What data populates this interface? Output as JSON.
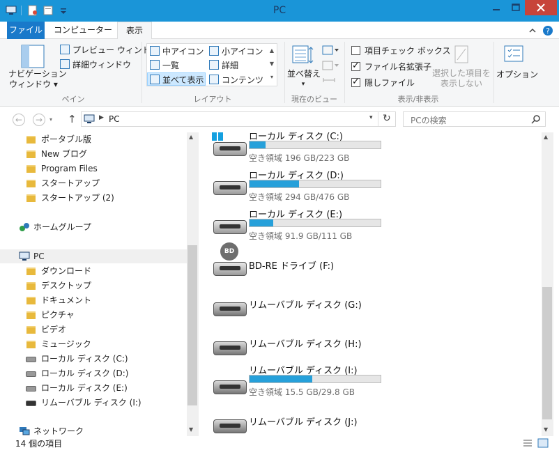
{
  "window": {
    "title": "PC"
  },
  "ribbon_tabs": {
    "file": "ファイル",
    "computer": "コンピューター",
    "view": "表示"
  },
  "ribbon": {
    "pane": {
      "navigation_pane": "ナビゲーション\nウィンドウ",
      "nav_line1": "ナビゲーション",
      "nav_line2": "ウィンドウ ▾",
      "preview_pane": "プレビュー ウィンドウ",
      "details_pane": "詳細ウィンドウ",
      "label": "ペイン"
    },
    "layout": {
      "medium_icons": "中アイコン",
      "small_icons": "小アイコン",
      "list": "一覧",
      "details": "詳細",
      "tiles": "並べて表示",
      "content": "コンテンツ",
      "label": "レイアウト"
    },
    "current_view": {
      "sort_line1": "並べ替え",
      "sort_line2": "▾",
      "label": "現在のビュー"
    },
    "show_hide": {
      "item_checkboxes": "項目チェック ボックス",
      "file_extensions": "ファイル名拡張子",
      "hidden_items": "隠しファイル",
      "hide_selected_line1": "選択した項目を",
      "hide_selected_line2": "表示しない",
      "label": "表示/非表示",
      "item_checkboxes_checked": false,
      "file_extensions_checked": true,
      "hidden_items_checked": true
    },
    "options": "オプション"
  },
  "address": {
    "path": "PC",
    "search_placeholder": "PCの検索"
  },
  "nav": {
    "items": [
      {
        "label": "ポータブル版",
        "icon": "folder-icon"
      },
      {
        "label": "New ブログ",
        "icon": "folder-icon"
      },
      {
        "label": "Program Files",
        "icon": "folder-icon"
      },
      {
        "label": "スタートアップ",
        "icon": "folder-icon"
      },
      {
        "label": "スタートアップ (2)",
        "icon": "folder-icon"
      }
    ],
    "homegroup": "ホームグループ",
    "pc": "PC",
    "pc_children": [
      {
        "label": "ダウンロード",
        "icon": "downloads-folder-icon"
      },
      {
        "label": "デスクトップ",
        "icon": "desktop-folder-icon"
      },
      {
        "label": "ドキュメント",
        "icon": "documents-folder-icon"
      },
      {
        "label": "ピクチャ",
        "icon": "pictures-folder-icon"
      },
      {
        "label": "ビデオ",
        "icon": "videos-folder-icon"
      },
      {
        "label": "ミュージック",
        "icon": "music-folder-icon"
      },
      {
        "label": "ローカル ディスク (C:)",
        "icon": "system-drive-icon"
      },
      {
        "label": "ローカル ディスク (D:)",
        "icon": "drive-icon"
      },
      {
        "label": "ローカル ディスク (E:)",
        "icon": "drive-icon"
      },
      {
        "label": "リムーバブル ディスク (I:)",
        "icon": "removable-drive-icon"
      }
    ],
    "network": "ネットワーク"
  },
  "drives": [
    {
      "name": "ローカル ディスク (C:)",
      "free_text": "空き領域 196 GB/223 GB",
      "used_fraction": 0.12,
      "type": "system"
    },
    {
      "name": "ローカル ディスク (D:)",
      "free_text": "空き領域 294 GB/476 GB",
      "used_fraction": 0.38,
      "type": "local"
    },
    {
      "name": "ローカル ディスク (E:)",
      "free_text": "空き領域 91.9 GB/111 GB",
      "used_fraction": 0.18,
      "type": "local"
    },
    {
      "name": "BD-RE ドライブ (F:)",
      "free_text": "",
      "used_fraction": null,
      "type": "optical"
    },
    {
      "name": "リムーバブル ディスク (G:)",
      "free_text": "",
      "used_fraction": null,
      "type": "removable"
    },
    {
      "name": "リムーバブル ディスク (H:)",
      "free_text": "",
      "used_fraction": null,
      "type": "removable"
    },
    {
      "name": "リムーバブル ディスク (I:)",
      "free_text": "空き領域 15.5 GB/29.8 GB",
      "used_fraction": 0.48,
      "type": "removable"
    },
    {
      "name": "リムーバブル ディスク (J:)",
      "free_text": "",
      "used_fraction": null,
      "type": "removable"
    }
  ],
  "status": {
    "item_count": "14 個の項目"
  },
  "colors": {
    "titlebar": "#1a95d8",
    "file_tab": "#1979ca",
    "close": "#c7443a",
    "capacity": "#26a0da"
  }
}
